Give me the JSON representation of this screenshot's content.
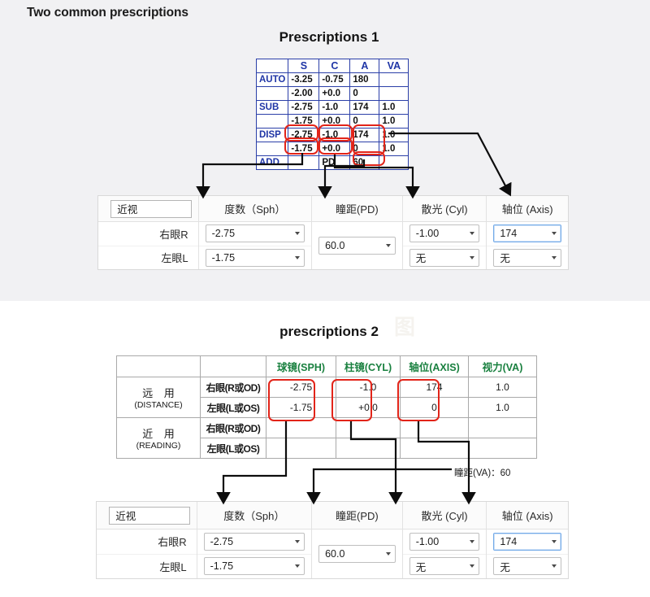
{
  "page": {
    "title": "Two common prescriptions"
  },
  "section1": {
    "title": "Prescriptions 1",
    "table": {
      "headers": [
        "",
        "S",
        "C",
        "A",
        "VA"
      ],
      "rows": [
        {
          "label": "AUTO",
          "s": "-3.25",
          "c": "-0.75",
          "a": "180",
          "va": ""
        },
        {
          "label": "",
          "s": "-2.00",
          "c": "+0.0",
          "a": "0",
          "va": ""
        },
        {
          "label": "SUB",
          "s": "-2.75",
          "c": "-1.0",
          "a": "174",
          "va": "1.0"
        },
        {
          "label": "",
          "s": "-1.75",
          "c": "+0.0",
          "a": "0",
          "va": "1.0"
        },
        {
          "label": "DISP",
          "s": "-2.75",
          "c": "-1.0",
          "a": "174",
          "va": "1.0"
        },
        {
          "label": "",
          "s": "-1.75",
          "c": "+0.0",
          "a": "0",
          "va": "1.0"
        },
        {
          "label": "ADD",
          "s": "",
          "c": "PD",
          "a": "60",
          "va": ""
        }
      ]
    },
    "form": {
      "type_value": "近视",
      "headers": [
        "度数（Sph）",
        "瞳距(PD)",
        "散光 (Cyl)",
        "轴位 (Axis)"
      ],
      "row_labels": [
        "右眼R",
        "左眼L"
      ],
      "sph": [
        "-2.75",
        "-1.75"
      ],
      "pd": "60.0",
      "cyl": [
        "-1.00",
        "无"
      ],
      "axis": [
        "174",
        "无"
      ]
    }
  },
  "section2": {
    "title": "prescriptions 2",
    "watermark": "图",
    "table": {
      "headers": [
        "",
        "",
        "球镜(SPH)",
        "柱镜(CYL)",
        "轴位(AXIS)",
        "视力(VA)"
      ],
      "groups": [
        {
          "use_cn": "远 用",
          "use_en": "(DISTANCE)",
          "rows": [
            {
              "eye": "右眼(R或OD)",
              "sph": "-2.75",
              "cyl": "-1.0",
              "axis": "174",
              "va": "1.0"
            },
            {
              "eye": "左眼(L或OS)",
              "sph": "-1.75",
              "cyl": "+0.0",
              "axis": "0",
              "va": "1.0"
            }
          ]
        },
        {
          "use_cn": "近 用",
          "use_en": "(READING)",
          "rows": [
            {
              "eye": "右眼(R或OD)",
              "sph": "",
              "cyl": "",
              "axis": "",
              "va": ""
            },
            {
              "eye": "左眼(L或OS)",
              "sph": "",
              "cyl": "",
              "axis": "",
              "va": ""
            }
          ]
        }
      ],
      "pd_note": "瞳距(VA)：60"
    },
    "form": {
      "type_value": "近视",
      "headers": [
        "度数（Sph）",
        "瞳距(PD)",
        "散光 (Cyl)",
        "轴位 (Axis)"
      ],
      "row_labels": [
        "右眼R",
        "左眼L"
      ],
      "sph": [
        "-2.75",
        "-1.75"
      ],
      "pd": "60.0",
      "cyl": [
        "-1.00",
        "无"
      ],
      "axis": [
        "174",
        "无"
      ]
    }
  },
  "colors": {
    "highlight": "#e22419",
    "table1_grid": "#2b3fa8",
    "table1_label": "#1f35a6",
    "table2_header": "#19803f",
    "section1_bg": "#f1f1f3",
    "focus_border": "#72a9e8"
  }
}
